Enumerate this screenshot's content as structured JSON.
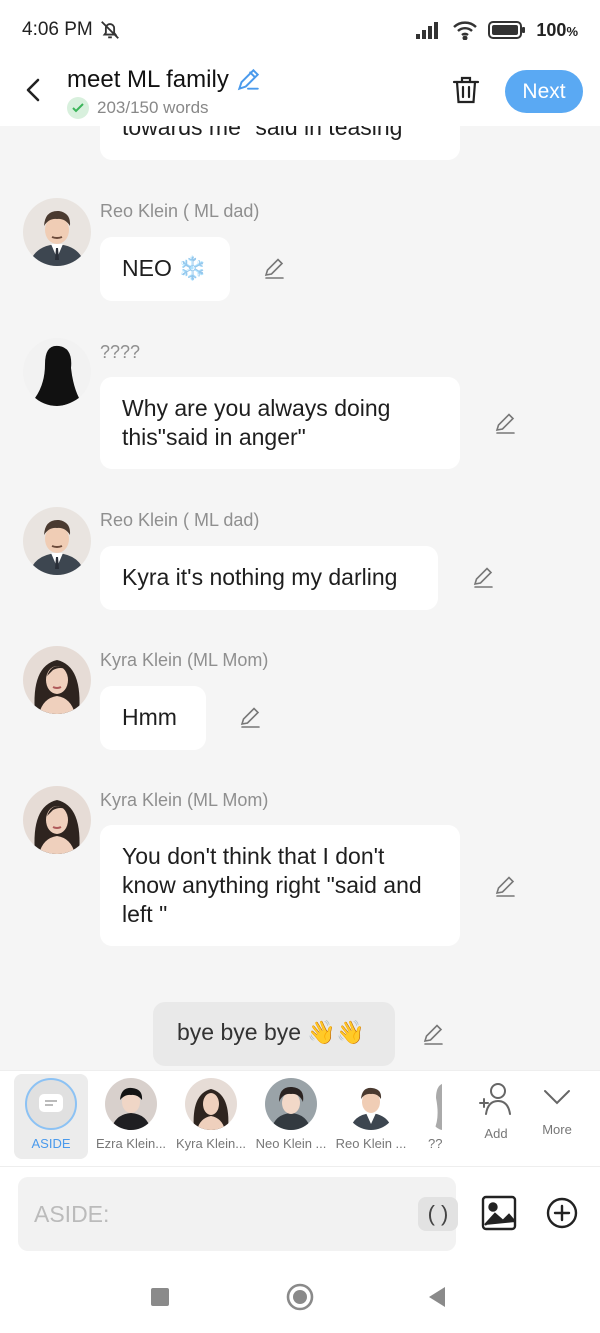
{
  "status": {
    "time": "4:06 PM",
    "battery": "100",
    "battery_unit": "%"
  },
  "header": {
    "title": "meet ML family",
    "words": "203/150 words",
    "next_label": "Next"
  },
  "messages": {
    "m0_text": "towards me \"said in teasing\"",
    "m1_name": "Reo Klein ( ML dad)",
    "m1_text": "NEO ❄️",
    "m2_name": "????",
    "m2_text": "Why are you always doing this\"said in anger\"",
    "m3_name": "Reo Klein ( ML dad)",
    "m3_text": "Kyra it's nothing my darling",
    "m4_name": "Kyra Klein (ML Mom)",
    "m4_text": "Hmm",
    "m5_name": "Kyra Klein (ML Mom)",
    "m5_text": "You don't think that I don't know anything right \"said and left \"",
    "aside_text": "bye bye bye 👋👋"
  },
  "characters": {
    "aside": "ASIDE",
    "c1": "Ezra Klein...",
    "c2": "Kyra Klein...",
    "c3": "Neo Klein ...",
    "c4": "Reo Klein ...",
    "c5": "??",
    "add": "Add",
    "more": "More"
  },
  "input": {
    "placeholder": "ASIDE:",
    "paren": "( )"
  },
  "colors": {
    "accent": "#5aa9f3",
    "bubble": "#ffffff",
    "aside_bubble": "#e9e9e9"
  }
}
